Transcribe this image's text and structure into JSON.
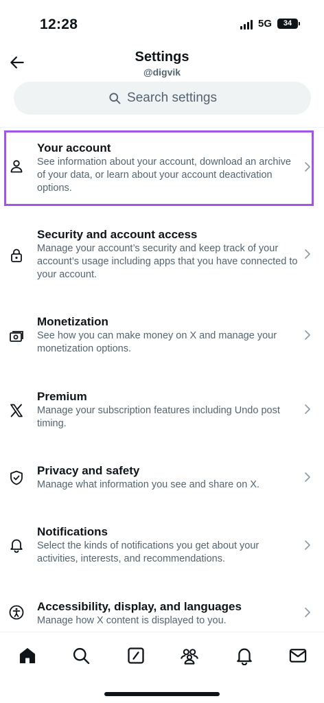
{
  "status_bar": {
    "time": "12:28",
    "network": "5G",
    "battery": "34"
  },
  "header": {
    "title": "Settings",
    "handle": "@digvik"
  },
  "search": {
    "placeholder": "Search settings"
  },
  "items": [
    {
      "title": "Your account",
      "description": "See information about your account, download an archive of your data, or learn about your account deactivation options.",
      "icon": "person-icon"
    },
    {
      "title": "Security and account access",
      "description": "Manage your account’s security and keep track of your account’s usage including apps that you have connected to your account.",
      "icon": "lock-icon"
    },
    {
      "title": "Monetization",
      "description": "See how you can make money on X and manage your monetization options.",
      "icon": "money-icon"
    },
    {
      "title": "Premium",
      "description": "Manage your subscription features including Undo post timing.",
      "icon": "x-logo-icon"
    },
    {
      "title": "Privacy and safety",
      "description": "Manage what information you see and share on X.",
      "icon": "shield-icon"
    },
    {
      "title": "Notifications",
      "description": "Select the kinds of notifications you get about your activities, interests, and recommendations.",
      "icon": "bell-icon"
    },
    {
      "title": "Accessibility, display, and languages",
      "description": "Manage how X content is displayed to you.",
      "icon": "accessibility-icon"
    }
  ],
  "tabs": [
    "home-icon",
    "search-icon",
    "compose-icon",
    "communities-icon",
    "notifications-icon",
    "messages-icon"
  ],
  "colors": {
    "highlight": "#a155e8",
    "secondary_text": "#536471",
    "search_bg": "#eff3f4"
  }
}
